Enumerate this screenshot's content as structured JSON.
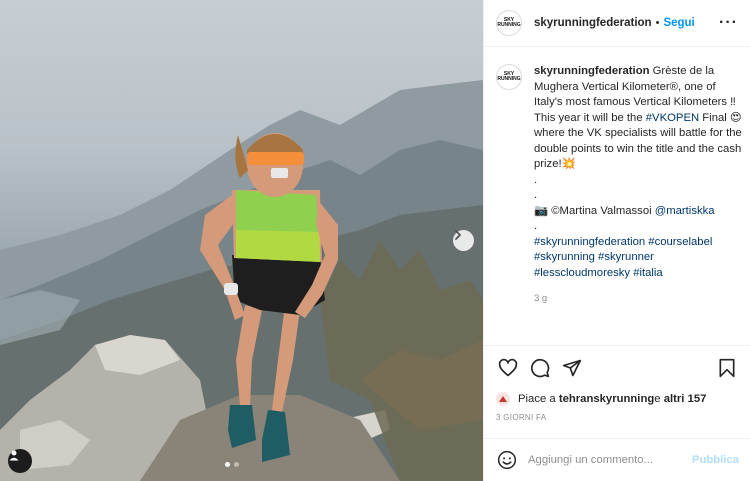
{
  "post": {
    "username": "skyrunningfederation",
    "follow_label": "Segui",
    "more_icon": "more-horizontal-icon",
    "logo_text": "SKY RUNNING"
  },
  "caption": {
    "username": "skyrunningfederation",
    "text": " Grèste de la Mughera Vertical Kilometer®, one of Italy's most famous Vertical Kilometers ‼ This year it will be the ",
    "hashtag_vkopen": "#VKOPEN",
    "text2": " Final 😍 where the VK specialists will battle for the double points to win the title and the cash prize!💥",
    "dot1": ".",
    "dot2": ".",
    "credit_prefix": "📷 ©Martina Valmassoi ",
    "credit_handle": "@martiskka",
    "dot3": ".",
    "hashtags_line1": "#skyrunningfederation #courselabel",
    "hashtags_line2": "#skyrunning #skyrunner",
    "hashtags_line3": "#lesscloudmoresky #italia",
    "age": "3 g"
  },
  "actions": {
    "likes_prefix": "Piace a ",
    "likes_user": "tehranskyrunning",
    "likes_mid": " e ",
    "likes_others": "altri 157",
    "when": "3 GIORNI FA"
  },
  "comment": {
    "placeholder": "Aggiungi un commento...",
    "publish_label": "Pubblica"
  },
  "carousel": {
    "current": 1,
    "total": 2
  },
  "colors": {
    "link": "#00376b",
    "follow": "#0095f6",
    "publish": "#b2dffc"
  }
}
